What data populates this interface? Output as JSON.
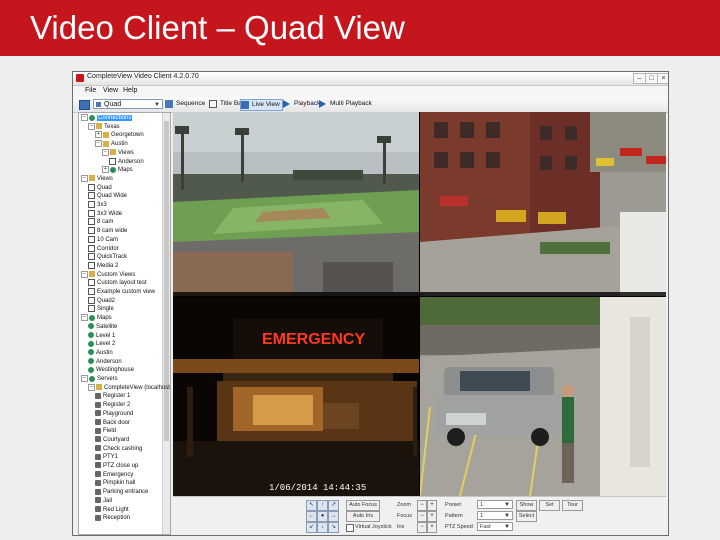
{
  "slide": {
    "title": "Video Client – Quad View",
    "accent_color": "#c4161c"
  },
  "window": {
    "title": "CompleteView Video Client 4.2.0.70",
    "controls": [
      "–",
      "□",
      "×"
    ]
  },
  "menu": [
    "File",
    "View",
    "Help"
  ],
  "toolbar": {
    "layout_value": "Quad",
    "buttons": [
      "Sequence",
      "Title Bar",
      "Live View",
      "Playback",
      "Multi Playback"
    ]
  },
  "tree": [
    {
      "label": "Connections",
      "depth": 1,
      "icon": "globe-icon",
      "expander": "−",
      "selected": true
    },
    {
      "label": "Texas",
      "depth": 2,
      "icon": "folder-icon",
      "expander": "−"
    },
    {
      "label": "Georgetown",
      "depth": 3,
      "icon": "folder-icon",
      "expander": "+"
    },
    {
      "label": "Austin",
      "depth": 3,
      "icon": "folder-icon",
      "expander": "−"
    },
    {
      "label": "Views",
      "depth": 4,
      "icon": "folder-icon",
      "expander": "−"
    },
    {
      "label": "Anderson",
      "depth": 5,
      "icon": "view-icon"
    },
    {
      "label": "Maps",
      "depth": 4,
      "icon": "globe-icon",
      "expander": "+"
    },
    {
      "label": "Views",
      "depth": 1,
      "icon": "folder-icon",
      "expander": "−"
    },
    {
      "label": "Quad",
      "depth": 2,
      "icon": "view-icon"
    },
    {
      "label": "Quad Wide",
      "depth": 2,
      "icon": "view-icon"
    },
    {
      "label": "3x3",
      "depth": 2,
      "icon": "view-icon"
    },
    {
      "label": "3x3 Wide",
      "depth": 2,
      "icon": "view-icon"
    },
    {
      "label": "8 cam",
      "depth": 2,
      "icon": "view-icon"
    },
    {
      "label": "8 cam wide",
      "depth": 2,
      "icon": "view-icon"
    },
    {
      "label": "10 Cam",
      "depth": 2,
      "icon": "view-icon"
    },
    {
      "label": "Corridor",
      "depth": 2,
      "icon": "view-icon"
    },
    {
      "label": "QuickTrack",
      "depth": 2,
      "icon": "view-icon"
    },
    {
      "label": "Media 2",
      "depth": 2,
      "icon": "view-icon"
    },
    {
      "label": "Custom Views",
      "depth": 1,
      "icon": "folder-icon",
      "expander": "−"
    },
    {
      "label": "Custom layout test",
      "depth": 2,
      "icon": "view-icon"
    },
    {
      "label": "Example custom view",
      "depth": 2,
      "icon": "view-icon"
    },
    {
      "label": "Quad2",
      "depth": 2,
      "icon": "view-icon"
    },
    {
      "label": "Single",
      "depth": 2,
      "icon": "view-icon"
    },
    {
      "label": "Maps",
      "depth": 1,
      "icon": "globe-icon",
      "expander": "−"
    },
    {
      "label": "Satellite",
      "depth": 2,
      "icon": "globe-icon"
    },
    {
      "label": "Level 1",
      "depth": 2,
      "icon": "globe-icon"
    },
    {
      "label": "Level 2",
      "depth": 2,
      "icon": "globe-icon"
    },
    {
      "label": "Austin",
      "depth": 2,
      "icon": "globe-icon"
    },
    {
      "label": "Anderson",
      "depth": 2,
      "icon": "globe-icon"
    },
    {
      "label": "Westinghouse",
      "depth": 2,
      "icon": "globe-icon"
    },
    {
      "label": "Servers",
      "depth": 1,
      "icon": "globe-icon",
      "expander": "−"
    },
    {
      "label": "CompleteView (localhost)",
      "depth": 2,
      "icon": "folder-icon",
      "expander": "−"
    },
    {
      "label": "Register 1",
      "depth": 3,
      "icon": "camera-icon"
    },
    {
      "label": "Register 2",
      "depth": 3,
      "icon": "camera-icon"
    },
    {
      "label": "Playground",
      "depth": 3,
      "icon": "camera-icon"
    },
    {
      "label": "Back door",
      "depth": 3,
      "icon": "camera-icon"
    },
    {
      "label": "Field",
      "depth": 3,
      "icon": "camera-icon"
    },
    {
      "label": "Courtyard",
      "depth": 3,
      "icon": "camera-icon"
    },
    {
      "label": "Check cashing",
      "depth": 3,
      "icon": "camera-icon"
    },
    {
      "label": "PTY1",
      "depth": 3,
      "icon": "camera-icon"
    },
    {
      "label": "PTZ close up",
      "depth": 3,
      "icon": "camera-icon"
    },
    {
      "label": "Emergency",
      "depth": 3,
      "icon": "camera-icon"
    },
    {
      "label": "Pimpkin hall",
      "depth": 3,
      "icon": "camera-icon"
    },
    {
      "label": "Parking entrance",
      "depth": 3,
      "icon": "camera-icon"
    },
    {
      "label": "Jail",
      "depth": 3,
      "icon": "camera-icon"
    },
    {
      "label": "Red Light",
      "depth": 3,
      "icon": "camera-icon"
    },
    {
      "label": "Reception",
      "depth": 3,
      "icon": "camera-icon"
    }
  ],
  "video": {
    "emergency_sign": "EMERGENCY",
    "timestamp": "1/06/2014  14:44:35"
  },
  "ptz": {
    "arrows": [
      "↖",
      "↑",
      "↗",
      "←",
      "●",
      "→",
      "↙",
      "↓",
      "↘"
    ],
    "auto_focus_label": "Auto Focus",
    "auto_iris_label": "Auto Iris",
    "virtual_joystick_label": "Virtual Joystick",
    "zoom_label": "Zoom",
    "focus_label": "Focus",
    "iris_label": "Iris",
    "minus": "−",
    "plus": "+",
    "preset_label": "Preset",
    "preset_value": "1",
    "pattern_label": "Pattern",
    "pattern_value": "1",
    "ptz_speed_label": "PTZ Speed",
    "ptz_speed_value": "Fast",
    "show_label": "Show",
    "set_label": "Set",
    "tour_label": "Tour",
    "select_label": "Select"
  }
}
